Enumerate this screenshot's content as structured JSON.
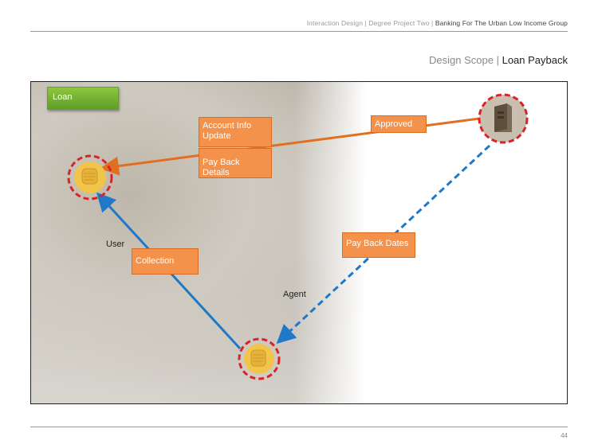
{
  "header": {
    "crumb1": "Interaction Design",
    "crumb2": "Degree Project Two",
    "crumb3": "Banking For The Urban Low Income Group",
    "sep": "|"
  },
  "title": {
    "section": "Design Scope",
    "sep": "|",
    "page": "Loan Payback"
  },
  "diagram": {
    "tag": "Loan",
    "account_info": "Account Info Update",
    "pay_back_details": "Pay Back Details",
    "approved": "Approved",
    "pay_back_dates": "Pay Back Dates",
    "collection": "Collection",
    "user_label": "User",
    "agent_label": "Agent"
  },
  "colors": {
    "orange_arrow": "#e07020",
    "blue_arrow": "#1f78c8",
    "box_fill": "#f4914a",
    "ring": "#d9232a",
    "tag_green": "#6fad30",
    "coin": "#f2c44a"
  },
  "icons": {
    "user_node": "hand-coin-icon",
    "agent_node": "hand-coin-icon",
    "bank_node": "bank-server-icon"
  },
  "footer": {
    "page_number": "44"
  }
}
